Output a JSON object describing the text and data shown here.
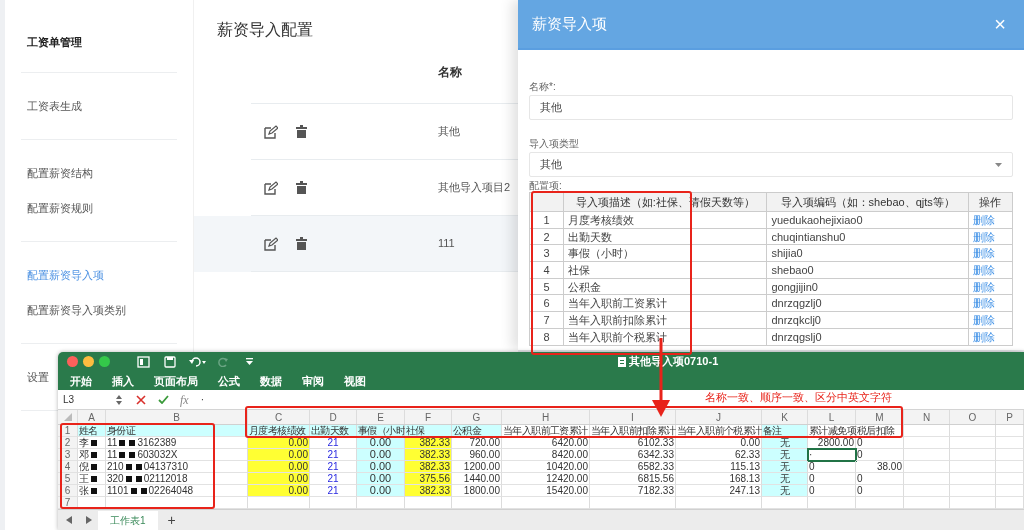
{
  "sidebar": {
    "groups": [
      {
        "items": [
          {
            "label": "工资单管理",
            "kind": "heading",
            "selected": false
          }
        ]
      },
      {
        "items": [
          {
            "label": "工资表生成",
            "kind": "link",
            "selected": false
          }
        ]
      },
      {
        "items": [
          {
            "label": "配置薪资结构",
            "kind": "link",
            "selected": false
          },
          {
            "label": "配置薪资规则",
            "kind": "link",
            "selected": false
          }
        ]
      },
      {
        "items": [
          {
            "label": "配置薪资导入项",
            "kind": "link",
            "selected": true
          },
          {
            "label": "配置薪资导入项类别",
            "kind": "link",
            "selected": false
          }
        ]
      },
      {
        "items": [
          {
            "label": "设置",
            "kind": "link",
            "selected": false
          }
        ]
      }
    ]
  },
  "page": {
    "title": "薪资导入配置",
    "table": {
      "column": "名称",
      "rows": [
        {
          "name": "其他",
          "selected": false
        },
        {
          "name": "其他导入项目2",
          "selected": false
        },
        {
          "name": "111",
          "selected": true
        }
      ]
    }
  },
  "dialog": {
    "title": "薪资导入项",
    "close": "×",
    "fields": [
      {
        "label": "名称*:",
        "value": "其他",
        "kind": "input"
      },
      {
        "label": "导入项类型",
        "value": "其他",
        "kind": "select"
      }
    ],
    "config_label": "配置项:",
    "table": {
      "columns": [
        "导入项描述（如:社保、请假天数等）",
        "导入项编码（如：shebao、qjts等）",
        "操作"
      ],
      "rows": [
        {
          "index": "1",
          "description": "月度考核绩效",
          "code": "yuedukaohejixiao0",
          "action": "删除"
        },
        {
          "index": "2",
          "description": "出勤天数",
          "code": "chuqintianshu0",
          "action": "删除"
        },
        {
          "index": "3",
          "description": "事假（小时）",
          "code": "shijia0",
          "action": "删除"
        },
        {
          "index": "4",
          "description": "社保",
          "code": "shebao0",
          "action": "删除"
        },
        {
          "index": "5",
          "description": "公积金",
          "code": "gongjijin0",
          "action": "删除"
        },
        {
          "index": "6",
          "description": "当年入职前工资累计",
          "code": "dnrzqgzlj0",
          "action": "删除"
        },
        {
          "index": "7",
          "description": "当年入职前扣除累计",
          "code": "dnrzqkclj0",
          "action": "删除"
        },
        {
          "index": "8",
          "description": "当年入职前个税累计",
          "code": "dnrzqgslj0",
          "action": "删除"
        }
      ]
    }
  },
  "spreadsheet": {
    "title": "其他导入项0710-1",
    "ribbon_tabs": [
      "开始",
      "插入",
      "页面布局",
      "公式",
      "数据",
      "审阅",
      "视图"
    ],
    "name_box": "L3",
    "function_label": "fx",
    "formula": "·",
    "columns": [
      "A",
      "B",
      "C",
      "D",
      "E",
      "F",
      "G",
      "H",
      "I",
      "J",
      "K",
      "L",
      "M",
      "N",
      "O",
      "P"
    ],
    "rows": [
      {
        "number": "1",
        "cells": [
          {
            "text": "姓名",
            "kind": "text",
            "color": "#ccffff"
          },
          {
            "text": "身份证",
            "kind": "text",
            "color": "#ccffff"
          },
          {
            "text": "月度考核绩效",
            "kind": "text",
            "color": "#ccffff"
          },
          {
            "text": "出勤天数",
            "kind": "text",
            "color": "#ccffff"
          },
          {
            "text": "事假（小时",
            "kind": "text",
            "color": "#ccffff"
          },
          {
            "text": "社保",
            "kind": "text",
            "color": "#ccffff"
          },
          {
            "text": "公积金",
            "kind": "text",
            "color": "#ccffff"
          },
          {
            "text": "当年入职前工资累计",
            "kind": "text"
          },
          {
            "text": "当年入职前扣除累计",
            "kind": "text"
          },
          {
            "text": "当年入职前个税累计",
            "kind": "text"
          },
          {
            "text": "备注",
            "kind": "text",
            "color": "#ccffff"
          },
          {
            "text": "累计减免项",
            "kind": "text"
          },
          {
            "text": "税后扣除",
            "kind": "text"
          }
        ]
      },
      {
        "number": "2",
        "cells": [
          {
            "text": "李",
            "kind": "masked"
          },
          {
            "text": "11",
            "suffix": "3162389",
            "kind": "masked"
          },
          {
            "text": "0.00",
            "kind": "number",
            "color": "#ffff33"
          },
          {
            "text": "21",
            "kind": "centered"
          },
          {
            "text": "0.00",
            "kind": "centered",
            "color": "#ccffff"
          },
          {
            "text": "382.33",
            "kind": "number",
            "color": "#ffff33"
          },
          {
            "text": "720.00",
            "kind": "number"
          },
          {
            "text": "6420.00",
            "kind": "number"
          },
          {
            "text": "6102.33",
            "kind": "number"
          },
          {
            "text": "0.00",
            "kind": "number"
          },
          {
            "text": "无",
            "kind": "centered",
            "color": "#ccffff"
          },
          {
            "text": "2800.00",
            "kind": "number"
          },
          {
            "text": "0",
            "kind": "text"
          }
        ]
      },
      {
        "number": "3",
        "cells": [
          {
            "text": "邓",
            "kind": "masked"
          },
          {
            "text": "11",
            "suffix": "603032X",
            "kind": "masked"
          },
          {
            "text": "0.00",
            "kind": "number",
            "color": "#ffff33"
          },
          {
            "text": "21",
            "kind": "centered"
          },
          {
            "text": "0.00",
            "kind": "centered",
            "color": "#ccffff"
          },
          {
            "text": "382.33",
            "kind": "number",
            "color": "#ffff33"
          },
          {
            "text": "960.00",
            "kind": "number"
          },
          {
            "text": "8420.00",
            "kind": "number"
          },
          {
            "text": "6342.33",
            "kind": "number"
          },
          {
            "text": "62.33",
            "kind": "number"
          },
          {
            "text": "无",
            "kind": "centered",
            "color": "#ccffff"
          },
          {
            "text": "·",
            "kind": "text",
            "selected": true
          },
          {
            "text": "0",
            "kind": "text"
          }
        ]
      },
      {
        "number": "4",
        "cells": [
          {
            "text": "倪",
            "kind": "masked"
          },
          {
            "text": "210",
            "suffix": "04137310",
            "kind": "masked"
          },
          {
            "text": "0.00",
            "kind": "number",
            "color": "#ffff33"
          },
          {
            "text": "21",
            "kind": "centered"
          },
          {
            "text": "0.00",
            "kind": "centered",
            "color": "#ccffff"
          },
          {
            "text": "382.33",
            "kind": "number",
            "color": "#ffff33"
          },
          {
            "text": "1200.00",
            "kind": "number"
          },
          {
            "text": "10420.00",
            "kind": "number"
          },
          {
            "text": "6582.33",
            "kind": "number"
          },
          {
            "text": "115.13",
            "kind": "number"
          },
          {
            "text": "无",
            "kind": "centered",
            "color": "#ccffff"
          },
          {
            "text": "0",
            "kind": "text"
          },
          {
            "text": "38.00",
            "kind": "number"
          }
        ]
      },
      {
        "number": "5",
        "cells": [
          {
            "text": "王",
            "kind": "masked"
          },
          {
            "text": "320",
            "suffix": "02112018",
            "kind": "masked"
          },
          {
            "text": "0.00",
            "kind": "number",
            "color": "#ffff33"
          },
          {
            "text": "21",
            "kind": "centered"
          },
          {
            "text": "0.00",
            "kind": "centered",
            "color": "#ccffff"
          },
          {
            "text": "375.56",
            "kind": "number",
            "color": "#ffff33"
          },
          {
            "text": "1440.00",
            "kind": "number"
          },
          {
            "text": "12420.00",
            "kind": "number"
          },
          {
            "text": "6815.56",
            "kind": "number"
          },
          {
            "text": "168.13",
            "kind": "number"
          },
          {
            "text": "无",
            "kind": "centered",
            "color": "#ccffff"
          },
          {
            "text": "0",
            "kind": "text"
          },
          {
            "text": "0",
            "kind": "text"
          }
        ]
      },
      {
        "number": "6",
        "cells": [
          {
            "text": "张",
            "kind": "masked"
          },
          {
            "text": "1101",
            "suffix": "02264048",
            "kind": "masked"
          },
          {
            "text": "0.00",
            "kind": "number",
            "color": "#ffff33"
          },
          {
            "text": "21",
            "kind": "centered"
          },
          {
            "text": "0.00",
            "kind": "centered",
            "color": "#ccffff"
          },
          {
            "text": "382.33",
            "kind": "number",
            "color": "#ffff33"
          },
          {
            "text": "1800.00",
            "kind": "number"
          },
          {
            "text": "15420.00",
            "kind": "number"
          },
          {
            "text": "7182.33",
            "kind": "number"
          },
          {
            "text": "247.13",
            "kind": "number"
          },
          {
            "text": "无",
            "kind": "centered",
            "color": "#ccffff"
          },
          {
            "text": "0",
            "kind": "text"
          },
          {
            "text": "0",
            "kind": "text"
          }
        ]
      },
      {
        "number": "7",
        "cells": []
      }
    ],
    "sheet_tabs": [
      {
        "label": "工作表1",
        "selected": true
      }
    ],
    "add_sheet": "+"
  },
  "annotation": {
    "note": "名称一致、顺序一致、区分中英文字符"
  }
}
